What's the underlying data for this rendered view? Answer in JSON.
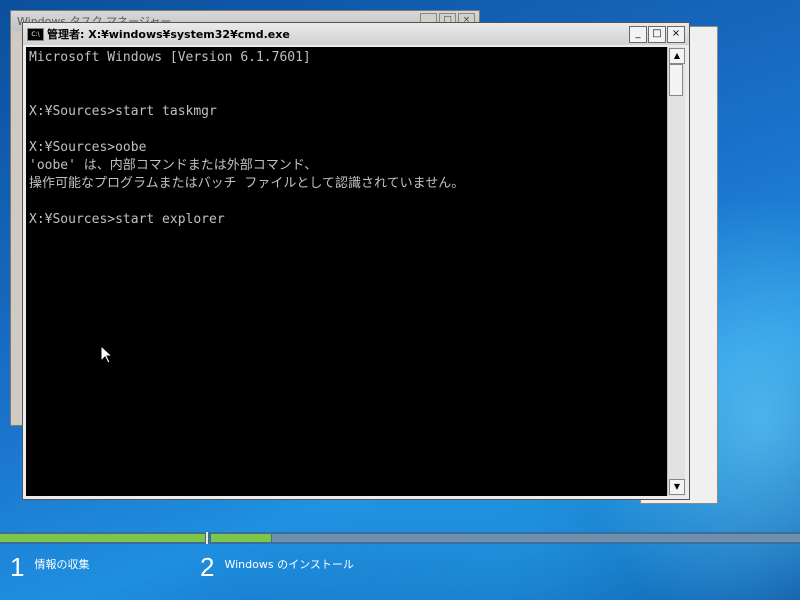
{
  "background_window": {
    "title": "Windows タスク マネージャー",
    "controls": [
      "_",
      "□",
      "×"
    ]
  },
  "cmd_window": {
    "title": "管理者: X:¥windows¥system32¥cmd.exe",
    "icon_label": "C:\\",
    "controls": {
      "minimize": "_",
      "maximize": "□",
      "close": "×"
    },
    "console_lines": [
      "Microsoft Windows [Version 6.1.7601]",
      "",
      "",
      "X:¥Sources>start taskmgr",
      "",
      "X:¥Sources>oobe",
      "'oobe' は、内部コマンドまたは外部コマンド、",
      "操作可能なプログラムまたはバッチ ファイルとして認識されていません。",
      "",
      "X:¥Sources>start explorer"
    ],
    "scroll_up": "▲",
    "scroll_down": "▼"
  },
  "setup_steps": [
    {
      "number": "1",
      "label": "情報の収集"
    },
    {
      "number": "2",
      "label": "Windows のインストール"
    }
  ],
  "colors": {
    "progress_done": "#7ec64a",
    "console_bg": "#000000",
    "console_text": "#c0c0c0"
  }
}
